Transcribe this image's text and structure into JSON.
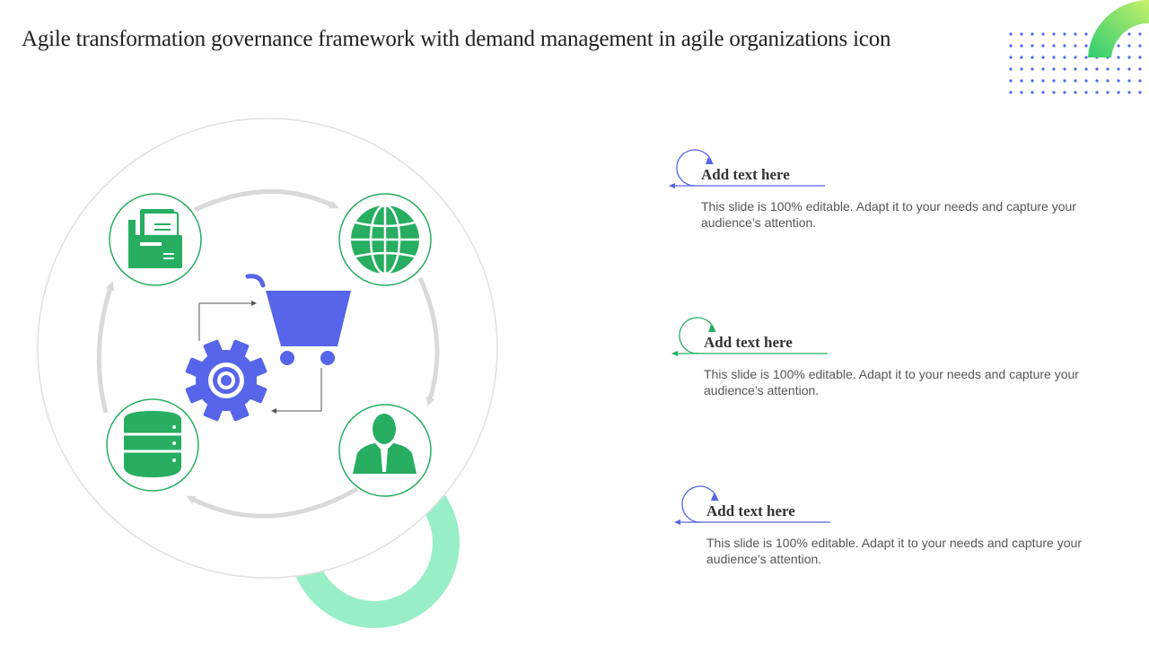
{
  "slide": {
    "title": "Agile transformation governance framework with demand management in agile organizations icon"
  },
  "colors": {
    "green": "#27AE60",
    "blue": "#5665E9",
    "mint": "#98EFC7",
    "light_green_gradient_start": "#B9F06A",
    "arrow_gray": "#D9D9D9"
  },
  "diagram": {
    "icons": [
      "folder-documents-icon",
      "globe-icon",
      "database-icon",
      "businessman-icon",
      "shopping-cart-icon",
      "gear-icon"
    ]
  },
  "items": [
    {
      "heading": "Add text here",
      "body": "This slide is 100% editable. Adapt it to your needs and capture your audience’s attention."
    },
    {
      "heading": "Add text here",
      "body": "This slide is 100% editable. Adapt it to your needs and capture your audience’s attention."
    },
    {
      "heading": "Add text here",
      "body": "This slide is 100% editable. Adapt it to your needs and capture your audience’s attention."
    }
  ]
}
